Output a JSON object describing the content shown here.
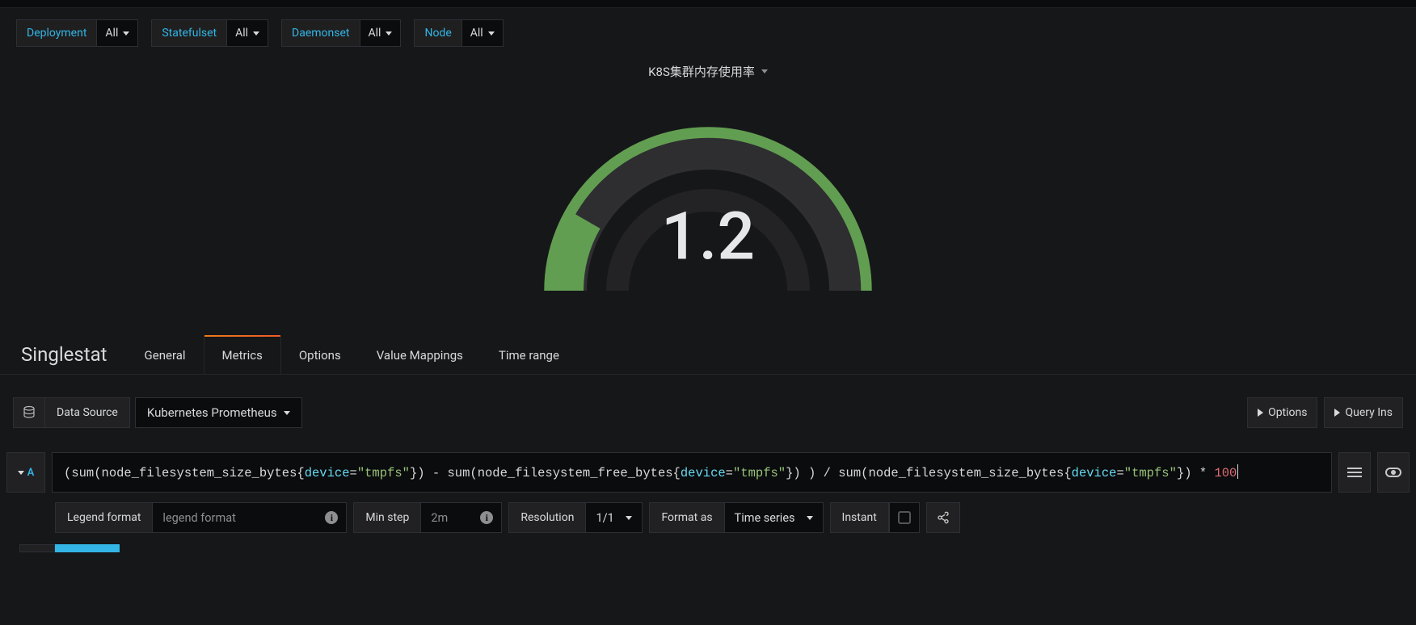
{
  "filters": [
    {
      "label": "Deployment",
      "value": "All"
    },
    {
      "label": "Statefulset",
      "value": "All"
    },
    {
      "label": "Daemonset",
      "value": "All"
    },
    {
      "label": "Node",
      "value": "All"
    }
  ],
  "panel": {
    "title": "K8S集群内存使用率",
    "gauge_value": "1.2",
    "gauge_fill_deg": 30,
    "colors": {
      "arc": "#629e51",
      "track": "#2f2f32"
    }
  },
  "editor": {
    "title": "Singlestat",
    "tabs": [
      "General",
      "Metrics",
      "Options",
      "Value Mappings",
      "Time range"
    ],
    "active_tab": "Metrics"
  },
  "datasource": {
    "label": "Data Source",
    "selected": "Kubernetes Prometheus",
    "right_buttons": [
      "Options",
      "Query Ins"
    ]
  },
  "query": {
    "ref_id": "A",
    "expr_tokens": [
      {
        "t": "c-paren",
        "v": "("
      },
      {
        "t": "c-func",
        "v": "sum"
      },
      {
        "t": "c-paren",
        "v": "("
      },
      {
        "t": "c-metric",
        "v": "node_filesystem_size_bytes"
      },
      {
        "t": "c-brace",
        "v": "{"
      },
      {
        "t": "c-key",
        "v": "device"
      },
      {
        "t": "c-eq",
        "v": "="
      },
      {
        "t": "c-str",
        "v": "\"tmpfs\""
      },
      {
        "t": "c-brace",
        "v": "}"
      },
      {
        "t": "c-paren",
        "v": ") "
      },
      {
        "t": "c-op",
        "v": "-"
      },
      {
        "t": "c-func",
        "v": " sum"
      },
      {
        "t": "c-paren",
        "v": "("
      },
      {
        "t": "c-metric",
        "v": "node_filesystem_free_bytes"
      },
      {
        "t": "c-brace",
        "v": "{"
      },
      {
        "t": "c-key",
        "v": "device"
      },
      {
        "t": "c-eq",
        "v": "="
      },
      {
        "t": "c-str",
        "v": "\"tmpfs\""
      },
      {
        "t": "c-brace",
        "v": "}"
      },
      {
        "t": "c-paren",
        "v": ") ) "
      },
      {
        "t": "c-op",
        "v": "/"
      },
      {
        "t": "c-func",
        "v": " sum"
      },
      {
        "t": "c-paren",
        "v": "("
      },
      {
        "t": "c-metric",
        "v": "node_filesystem_size_bytes"
      },
      {
        "t": "c-brace",
        "v": "{"
      },
      {
        "t": "c-key",
        "v": "device"
      },
      {
        "t": "c-eq",
        "v": "="
      },
      {
        "t": "c-str",
        "v": "\"tmpfs\""
      },
      {
        "t": "c-brace",
        "v": "}"
      },
      {
        "t": "c-paren",
        "v": ") "
      },
      {
        "t": "c-op",
        "v": "*"
      },
      {
        "t": "c-plain",
        "v": " "
      },
      {
        "t": "c-num",
        "v": "100"
      }
    ]
  },
  "query_opts": {
    "legend_format_label": "Legend format",
    "legend_format_placeholder": "legend format",
    "min_step_label": "Min step",
    "min_step_placeholder": "2m",
    "resolution_label": "Resolution",
    "resolution_value": "1/1",
    "format_as_label": "Format as",
    "format_as_value": "Time series",
    "instant_label": "Instant",
    "instant_checked": false
  }
}
